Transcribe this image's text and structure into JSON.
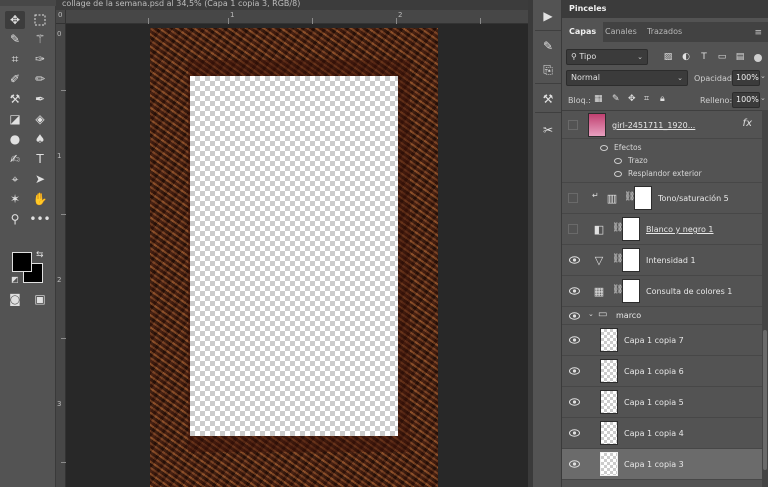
{
  "document": {
    "title": "collage de la semana.psd al 34,5% (Capa 1 copia 3, RGB/8)"
  },
  "rulers": {
    "top_numbers": [
      "0",
      "1",
      "2"
    ],
    "left_numbers": [
      "0",
      "1",
      "2",
      "3"
    ]
  },
  "toolbar": {
    "tools": [
      "move-tool",
      "marquee-tool",
      "lasso-tool",
      "magic-wand-tool",
      "crop-tool",
      "eyedropper-tool",
      "healing-brush-tool",
      "brush-tool",
      "clone-stamp-tool",
      "history-brush-tool",
      "eraser-tool",
      "paint-bucket-tool",
      "blur-tool",
      "dodge-tool",
      "pen-tool",
      "type-tool",
      "path-selection-tool",
      "direct-selection-tool",
      "custom-shape-tool",
      "hand-tool",
      "zoom-tool",
      "more-tools"
    ],
    "foreground_color": "#000000",
    "background_color": "#000000"
  },
  "right_panel": {
    "header": "Pinceles",
    "tabs": [
      "Capas",
      "Canales",
      "Trazados"
    ],
    "active_tab": "Capas",
    "filter": {
      "label": "Tipo"
    },
    "blend_mode": "Normal",
    "opacity_label": "Opacidad:",
    "opacity_value": "100%",
    "lock_label": "Bloq.:",
    "fill_label": "Relleno:",
    "fill_value": "100%",
    "layers": [
      {
        "name": "girl-2451711_1920...",
        "kind": "photo",
        "has_fx": true,
        "visible": false
      },
      {
        "name": "Tono/saturación 5",
        "kind": "adjustment",
        "visible": false
      },
      {
        "name": "Blanco y negro 1",
        "kind": "adjustment",
        "visible": false
      },
      {
        "name": "Intensidad 1",
        "kind": "adjustment",
        "visible": true
      },
      {
        "name": "Consulta de colores 1",
        "kind": "adjustment",
        "visible": true
      },
      {
        "name": "marco",
        "kind": "group",
        "visible": true
      },
      {
        "name": "Capa 1 copia 7",
        "kind": "layer",
        "visible": true
      },
      {
        "name": "Capa 1 copia 6",
        "kind": "layer",
        "visible": true
      },
      {
        "name": "Capa 1 copia 5",
        "kind": "layer",
        "visible": true
      },
      {
        "name": "Capa 1 copia 4",
        "kind": "layer",
        "visible": true
      },
      {
        "name": "Capa 1 copia 3",
        "kind": "layer",
        "visible": true,
        "selected": true
      }
    ],
    "effects": {
      "label": "Efectos",
      "items": [
        "Trazo",
        "Resplandor exterior"
      ]
    },
    "fx_label": "fx"
  }
}
